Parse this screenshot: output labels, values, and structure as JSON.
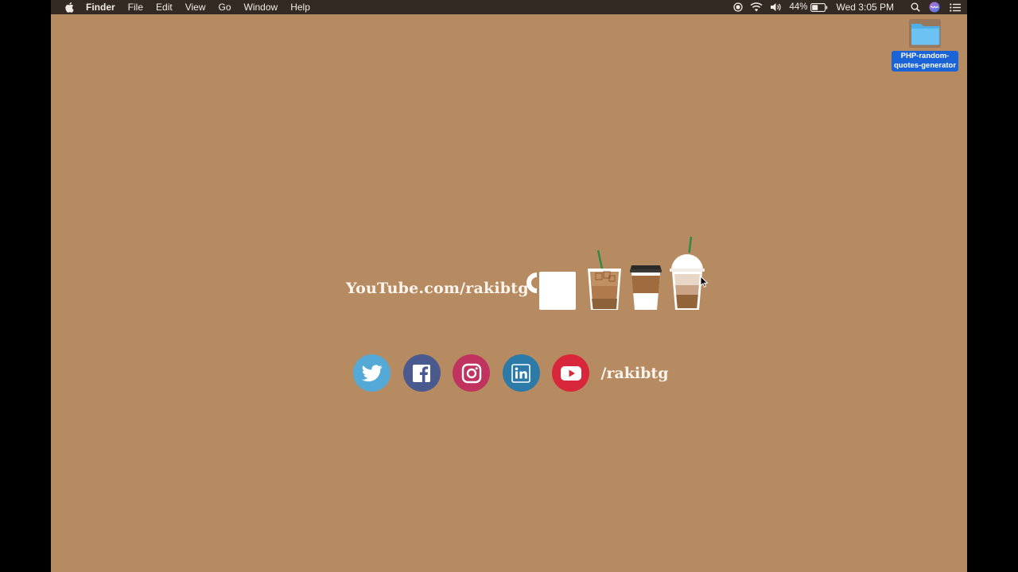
{
  "menubar": {
    "app_name": "Finder",
    "menus": [
      "File",
      "Edit",
      "View",
      "Go",
      "Window",
      "Help"
    ],
    "battery_percent": "44%",
    "datetime": "Wed 3:05 PM",
    "status_icons": [
      "screen-record-icon",
      "wifi-icon",
      "volume-icon",
      "battery-icon",
      "spotlight-search-icon",
      "siri-icon",
      "notification-center-icon"
    ]
  },
  "desktop": {
    "folder_label": "PHP-random-\nquotes-generator",
    "background_color": "#b68b62"
  },
  "content": {
    "youtube_text": "YouTube.com/rakibtg",
    "handle_text": "/rakibtg",
    "cups": [
      "mug-icon",
      "iced-coffee-icon",
      "takeaway-coffee-icon",
      "frappuccino-icon"
    ],
    "social": [
      {
        "name": "twitter-icon",
        "color": "#55a9d6"
      },
      {
        "name": "facebook-icon",
        "color": "#4a5a8f"
      },
      {
        "name": "instagram-icon",
        "color": "#c0335f"
      },
      {
        "name": "linkedin-icon",
        "color": "#2b7aa7"
      },
      {
        "name": "youtube-icon",
        "color": "#d8263a"
      }
    ]
  }
}
